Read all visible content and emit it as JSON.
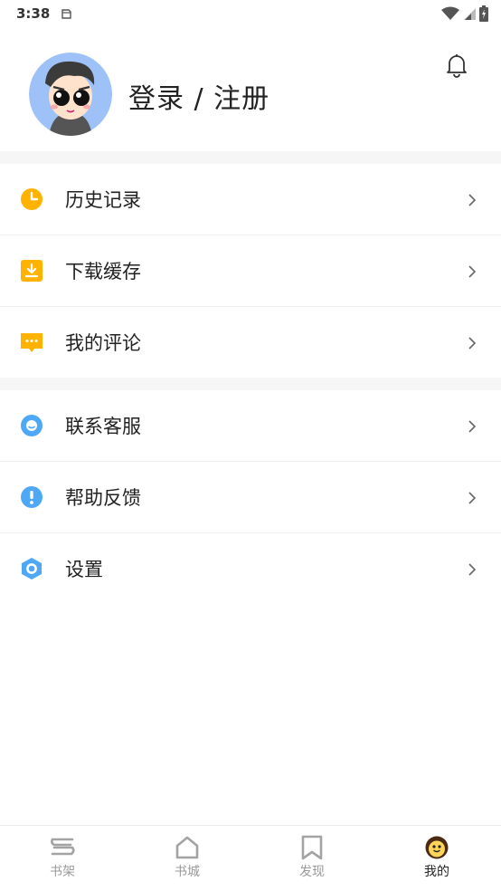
{
  "status_bar": {
    "time": "3:38"
  },
  "profile": {
    "login_label": "登录 / 注册"
  },
  "menu_group_1": [
    {
      "label": "历史记录",
      "icon": "clock-icon",
      "color": "#FFB300"
    },
    {
      "label": "下载缓存",
      "icon": "download-icon",
      "color": "#FFB300"
    },
    {
      "label": "我的评论",
      "icon": "comment-icon",
      "color": "#FFB300"
    }
  ],
  "menu_group_2": [
    {
      "label": "联系客服",
      "icon": "customer-service-icon",
      "color": "#4FA8F5"
    },
    {
      "label": "帮助反馈",
      "icon": "help-icon",
      "color": "#4FA8F5"
    },
    {
      "label": "设置",
      "icon": "settings-icon",
      "color": "#4FA8F5"
    }
  ],
  "tabs": [
    {
      "label": "书架",
      "icon": "bookshelf-icon",
      "active": false
    },
    {
      "label": "书城",
      "icon": "bookstore-icon",
      "active": false
    },
    {
      "label": "发现",
      "icon": "discover-icon",
      "active": false
    },
    {
      "label": "我的",
      "icon": "mine-icon",
      "active": true
    }
  ],
  "colors": {
    "accent_yellow": "#FFB300",
    "accent_blue": "#4FA8F5",
    "section_gap": "#F6F6F6"
  }
}
